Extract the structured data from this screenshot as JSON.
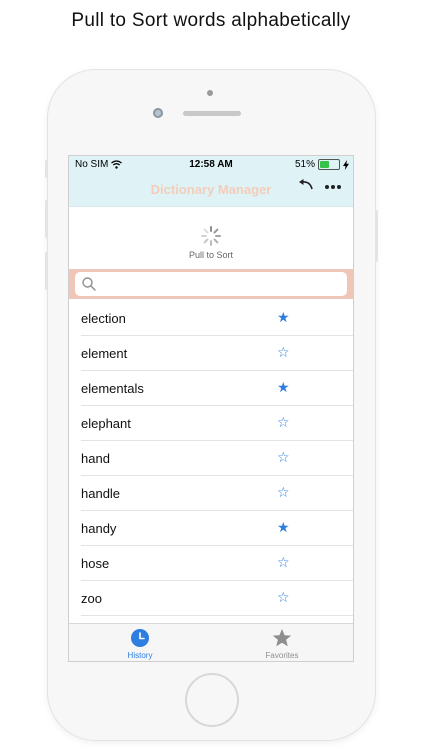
{
  "promo": {
    "title": "Pull to Sort words alphabetically"
  },
  "status": {
    "carrier": "No SIM",
    "time": "12:58 AM",
    "battery": "51%",
    "battery_level": 0.51
  },
  "nav": {
    "title": "Dictionary Manager",
    "back_icon": "undo-icon",
    "more_icon": "more-icon"
  },
  "refresh": {
    "label": "Pull to Sort"
  },
  "search": {
    "placeholder": "",
    "value": ""
  },
  "words": [
    {
      "word": "election",
      "favorite": true
    },
    {
      "word": "element",
      "favorite": false
    },
    {
      "word": "elementals",
      "favorite": true
    },
    {
      "word": "elephant",
      "favorite": false
    },
    {
      "word": "hand",
      "favorite": false
    },
    {
      "word": "handle",
      "favorite": false
    },
    {
      "word": "handy",
      "favorite": true
    },
    {
      "word": "hose",
      "favorite": false
    },
    {
      "word": "zoo",
      "favorite": false
    }
  ],
  "tabs": [
    {
      "label": "History",
      "active": true,
      "icon": "clock-icon"
    },
    {
      "label": "Favorites",
      "active": false,
      "icon": "star-icon"
    }
  ],
  "colors": {
    "accent": "#2e7de0",
    "nav_bg": "#dff3f7",
    "search_bg": "#f0c6b8",
    "title": "#f3cdb8",
    "inactive": "#8e8e8e"
  }
}
